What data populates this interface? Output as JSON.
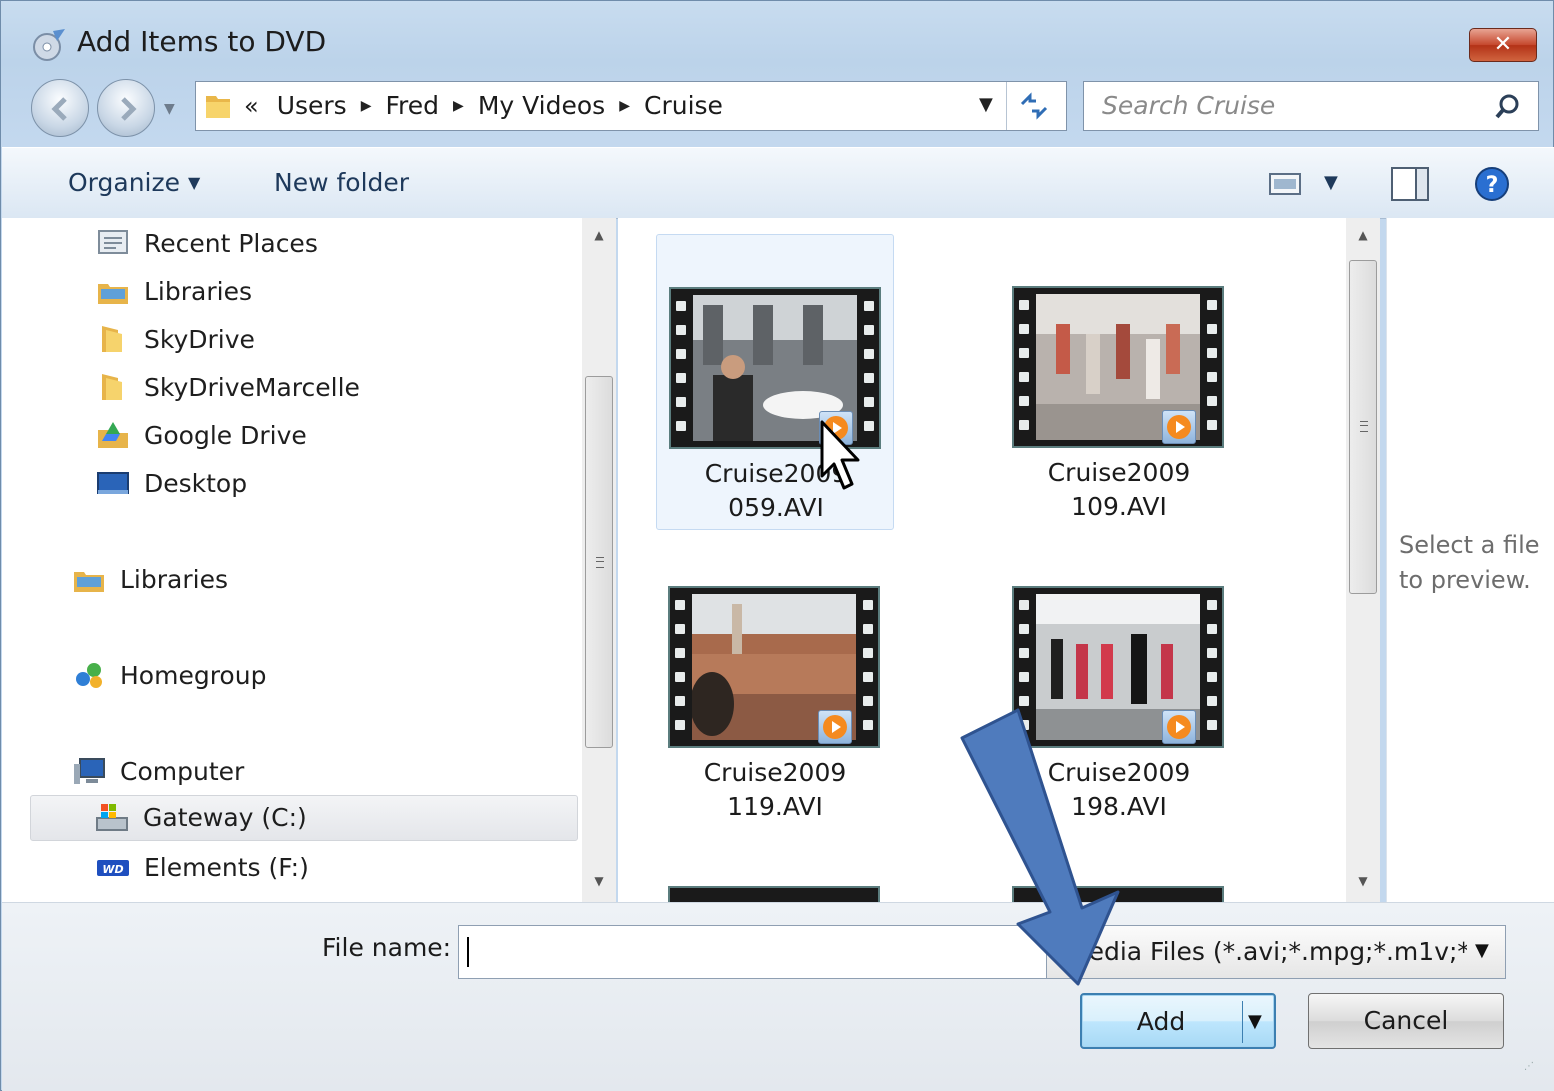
{
  "window": {
    "title": "Add Items to DVD",
    "close_label": "✕"
  },
  "address": {
    "overflow_glyph": "«",
    "crumbs": [
      "Users",
      "Fred",
      "My Videos",
      "Cruise"
    ]
  },
  "search": {
    "placeholder": "Search Cruise"
  },
  "toolbar": {
    "organize_label": "Organize",
    "new_folder_label": "New folder"
  },
  "nav": {
    "items": [
      {
        "label": "Recent Places",
        "icon": "recent-places-icon"
      },
      {
        "label": "Libraries",
        "icon": "libraries-icon"
      },
      {
        "label": "SkyDrive",
        "icon": "folder-icon"
      },
      {
        "label": "SkyDriveMarcelle",
        "icon": "folder-icon"
      },
      {
        "label": "Google Drive",
        "icon": "google-drive-icon"
      },
      {
        "label": "Desktop",
        "icon": "desktop-icon"
      },
      {
        "label": "Libraries",
        "icon": "libraries-icon"
      },
      {
        "label": "Homegroup",
        "icon": "homegroup-icon"
      },
      {
        "label": "Computer",
        "icon": "computer-icon"
      },
      {
        "label": "Gateway (C:)",
        "icon": "drive-icon",
        "selected": true
      },
      {
        "label": "Elements (F:)",
        "icon": "wd-drive-icon"
      }
    ]
  },
  "files": [
    {
      "label": "Cruise2009\n059.AVI",
      "scene": "cafe"
    },
    {
      "label": "Cruise2009\n109.AVI",
      "scene": "dance-deck"
    },
    {
      "label": "Cruise2009\n119.AVI",
      "scene": "city-rooftops"
    },
    {
      "label": "Cruise2009\n198.AVI",
      "scene": "dance-line"
    }
  ],
  "preview": {
    "text": "Select a file\nto preview."
  },
  "bottom": {
    "filename_label": "File name:",
    "filename_value": "",
    "filter_value": "Media Files (*.avi;*.mpg;*.m1v;*",
    "add_label": "Add",
    "cancel_label": "Cancel"
  },
  "colors": {
    "accent": "#3c7fb1",
    "annotation_arrow": "#4f7bbd",
    "close": "#c5472c"
  }
}
